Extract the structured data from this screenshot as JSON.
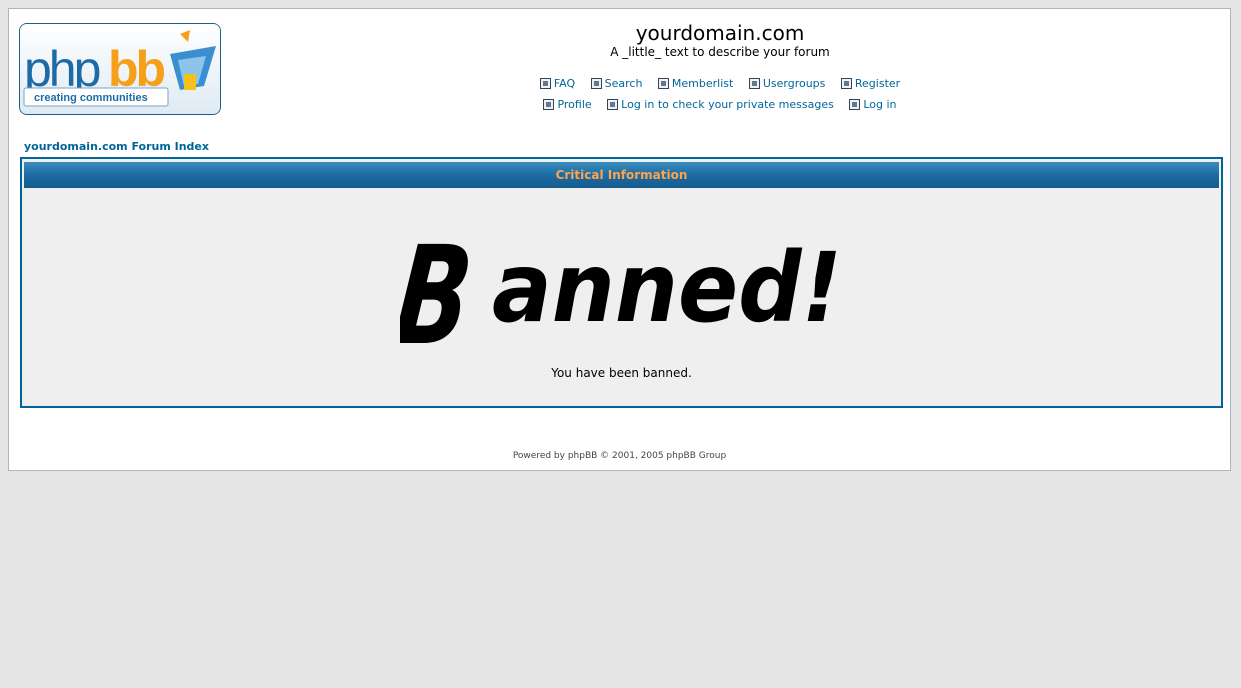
{
  "logo": {
    "text_php": "php",
    "text_bb": "bb",
    "tagline": "creating communities"
  },
  "header": {
    "site_title": "yourdomain.com",
    "site_description": "A _little_ text to describe your forum"
  },
  "nav": {
    "row1": [
      {
        "label": "FAQ",
        "icon": "faq-icon"
      },
      {
        "label": "Search",
        "icon": "search-icon"
      },
      {
        "label": "Memberlist",
        "icon": "memberlist-icon"
      },
      {
        "label": "Usergroups",
        "icon": "usergroups-icon"
      },
      {
        "label": "Register",
        "icon": "register-icon"
      }
    ],
    "row2": [
      {
        "label": "Profile",
        "icon": "profile-icon"
      },
      {
        "label": "Log in to check your private messages",
        "icon": "messages-icon"
      },
      {
        "label": "Log in",
        "icon": "login-icon"
      }
    ]
  },
  "breadcrumb": "yourdomain.com Forum Index",
  "panel": {
    "title": "Critical Information",
    "banned_graphic_text": "Banned!",
    "message": "You have been banned."
  },
  "footer": "Powered by phpBB © 2001, 2005 phpBB Group",
  "colors": {
    "link": "#006699",
    "header_gradient": "#1e6fa6",
    "header_text": "#ffa34f",
    "page_bg": "#e5e5e5",
    "panel_bg": "#efefef"
  }
}
